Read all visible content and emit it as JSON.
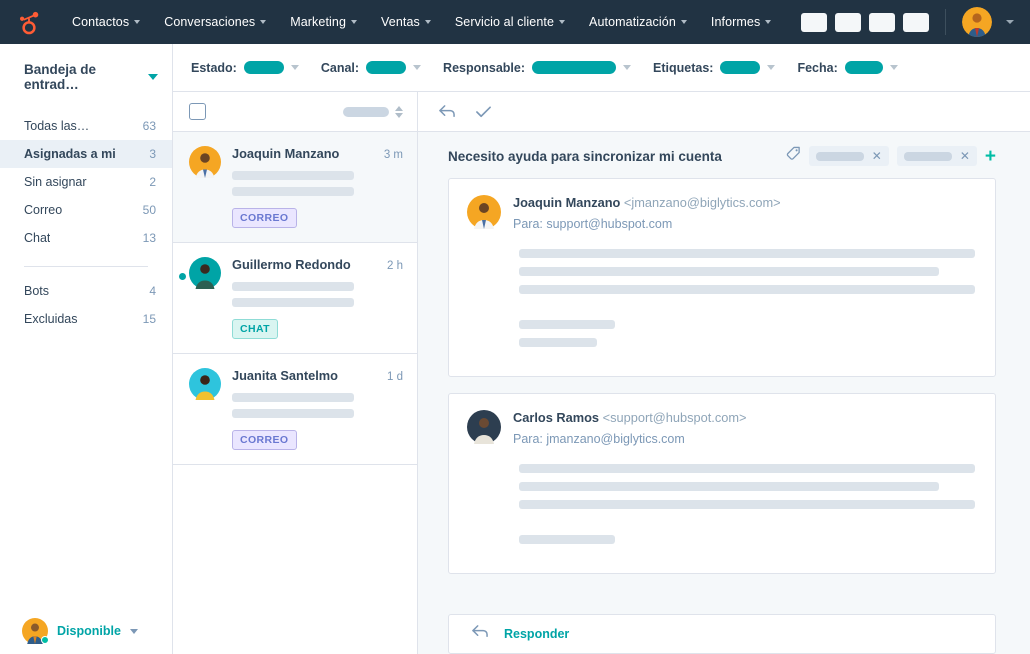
{
  "topnav": {
    "logo_icon": "hubspot-sprocket-logo",
    "items": [
      {
        "label": "Contactos"
      },
      {
        "label": "Conversaciones"
      },
      {
        "label": "Marketing"
      },
      {
        "label": "Ventas"
      },
      {
        "label": "Servicio al cliente"
      },
      {
        "label": "Automatización"
      },
      {
        "label": "Informes"
      }
    ],
    "action_boxes": 4,
    "avatar_icon": "user-avatar"
  },
  "sidebar": {
    "title": "Bandeja de entrad…",
    "items": [
      {
        "label": "Todas las…",
        "count": "63",
        "active": false
      },
      {
        "label": "Asignadas a mi",
        "count": "3",
        "active": true
      },
      {
        "label": "Sin asignar",
        "count": "2",
        "active": false
      },
      {
        "label": "Correo",
        "count": "50",
        "active": false
      },
      {
        "label": "Chat",
        "count": "13",
        "active": false
      }
    ],
    "items_secondary": [
      {
        "label": "Bots",
        "count": "4"
      },
      {
        "label": "Excluidas",
        "count": "15"
      }
    ],
    "status": {
      "label": "Disponible",
      "online_color": "#00bda5"
    }
  },
  "filters": [
    {
      "label": "Estado:",
      "value_width": 40
    },
    {
      "label": "Canal:",
      "value_width": 40
    },
    {
      "label": "Responsable:",
      "value_width": 84
    },
    {
      "label": "Etiquetas:",
      "value_width": 40
    },
    {
      "label": "Fecha:",
      "value_width": 38
    }
  ],
  "conversation_list": {
    "select_all_checkbox": false,
    "items": [
      {
        "name": "Joaquin Manzano",
        "time": "3 m",
        "badge": "CORREO",
        "badge_type": "correo",
        "unread": false,
        "selected": true,
        "avatar_bg": "#f5a623"
      },
      {
        "name": "Guillermo Redondo",
        "time": "2 h",
        "badge": "CHAT",
        "badge_type": "chat",
        "unread": true,
        "selected": false,
        "avatar_bg": "#00a4a6"
      },
      {
        "name": "Juanita Santelmo",
        "time": "1 d",
        "badge": "CORREO",
        "badge_type": "correo",
        "unread": false,
        "selected": false,
        "avatar_bg": "#2ec4dd"
      }
    ]
  },
  "detail": {
    "actions": [
      "reply-arrow-icon",
      "check-icon"
    ],
    "subject": "Necesito ayuda para sincronizar mi cuenta",
    "tag_icon": "tag-icon",
    "tag_chips": 2,
    "add_tag_label": "+",
    "messages": [
      {
        "from_name": "Joaquin Manzano",
        "from_email": "<jmanzano@biglytics.com>",
        "to_line": "Para: support@hubspot.com",
        "avatar_bg": "#f5a623",
        "body_lines": [
          {
            "width": "100%"
          },
          {
            "width": "92%"
          },
          {
            "width": "100%"
          },
          {
            "width": "0",
            "spacer": true
          },
          {
            "width": "30%"
          },
          {
            "width": "25%"
          }
        ]
      },
      {
        "from_name": "Carlos Ramos",
        "from_email": "<support@hubspot.com>",
        "to_line": "Para: jmanzano@biglytics.com",
        "avatar_bg": "#2d3e50",
        "body_lines": [
          {
            "width": "100%"
          },
          {
            "width": "92%"
          },
          {
            "width": "100%"
          },
          {
            "width": "0",
            "spacer": true
          },
          {
            "width": "24%"
          }
        ]
      }
    ],
    "reply": {
      "icon": "reply-arrow-icon",
      "label": "Responder"
    }
  },
  "colors": {
    "nav_bg": "#213343",
    "accent_teal": "#00a4a6",
    "brand_orange": "#ff5c35",
    "text_dark": "#33475b",
    "text_muted": "#7c98b6",
    "border": "#dfe3eb",
    "panel_bg": "#f5f8fa",
    "placeholder": "#dce3ea"
  }
}
